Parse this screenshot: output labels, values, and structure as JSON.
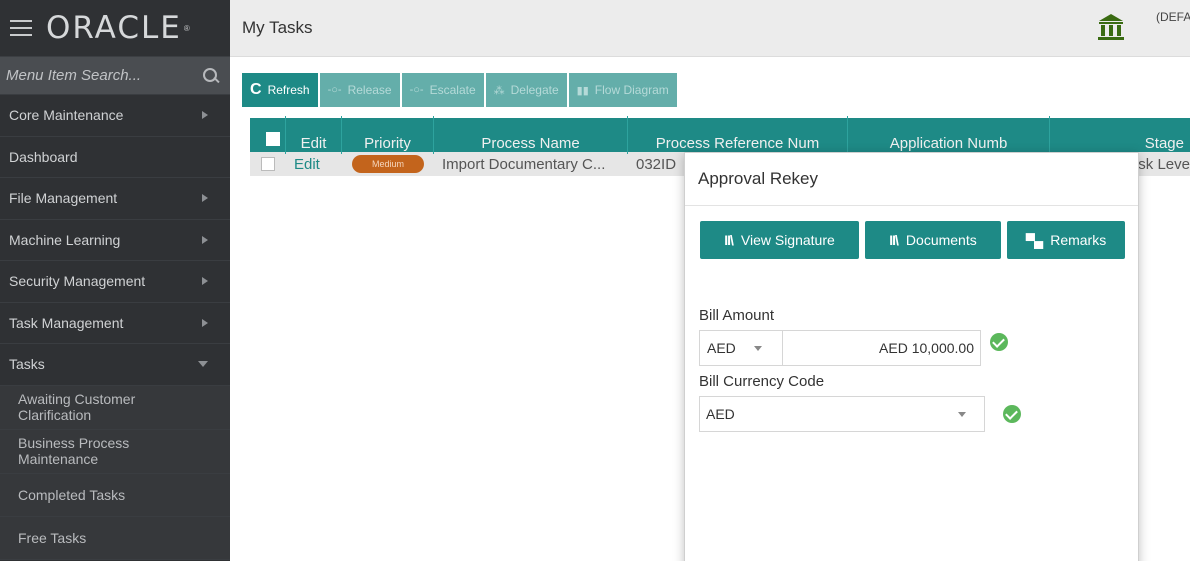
{
  "brand": {
    "logo_text": "ORACLE",
    "logo_mark": "®"
  },
  "sidebar": {
    "search_placeholder": "Menu Item Search...",
    "menu_items": [
      {
        "label": "Core Maintenance",
        "expandable": true
      },
      {
        "label": "Dashboard",
        "expandable": false
      },
      {
        "label": "File Management",
        "expandable": true
      },
      {
        "label": "Machine Learning",
        "expandable": true
      },
      {
        "label": "Security Management",
        "expandable": true
      },
      {
        "label": "Task Management",
        "expandable": true
      },
      {
        "label": "Tasks",
        "expandable": true,
        "expanded": true
      }
    ],
    "sub_items": [
      {
        "label": "Awaiting Customer Clarification"
      },
      {
        "label": "Business Process Maintenance"
      },
      {
        "label": "Completed Tasks"
      },
      {
        "label": "Free Tasks"
      }
    ]
  },
  "header": {
    "title": "My Tasks",
    "user_text": "(DEFA"
  },
  "toolbar": {
    "refresh": "Refresh",
    "release": "Release",
    "escalate": "Escalate",
    "delegate": "Delegate",
    "flow_diagram": "Flow Diagram"
  },
  "table": {
    "columns": [
      "Edit",
      "Priority",
      "Process Name",
      "Process Reference Num",
      "Application Numb",
      "Stage"
    ],
    "rows": [
      {
        "edit": "Edit",
        "priority": "Medium",
        "process_name": "Import Documentary C...",
        "process_ref": "032ID",
        "application_num": "",
        "stage": "sk Leve"
      }
    ]
  },
  "modal": {
    "title": "Approval Rekey",
    "buttons": {
      "view_signature": "View Signature",
      "documents": "Documents",
      "remarks": "Remarks"
    },
    "bill_amount": {
      "label": "Bill Amount",
      "currency": "AED",
      "value": "AED 10,000.00"
    },
    "bill_currency_code": {
      "label": "Bill Currency Code",
      "value": "AED"
    }
  },
  "colors": {
    "teal": "#1e8a86",
    "sidebar_bg": "#2f3134",
    "badge": "#c3641c",
    "success": "#5cb85c"
  }
}
